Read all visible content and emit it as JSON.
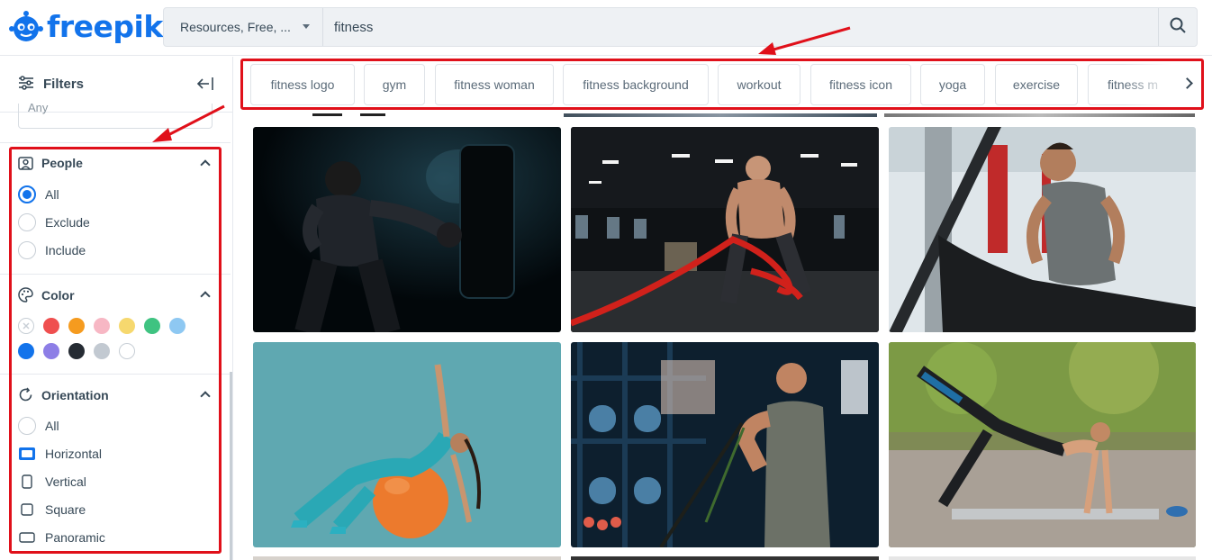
{
  "header": {
    "logo_text": "freepik",
    "search_type": "Resources, Free, ...",
    "search_value": "fitness",
    "brand_color": "#1273eb"
  },
  "sidebar": {
    "filters_label": "Filters",
    "any_select": "Any",
    "people": {
      "title": "People",
      "options": [
        {
          "label": "All",
          "selected": true
        },
        {
          "label": "Exclude",
          "selected": false
        },
        {
          "label": "Include",
          "selected": false
        }
      ]
    },
    "color": {
      "title": "Color",
      "swatches": [
        "none",
        "#ef4f4f",
        "#f59b1f",
        "#f7b7c4",
        "#f6d86e",
        "#3fc381",
        "#8ec8f2",
        "#1273eb",
        "#8d7ee6",
        "#252b33",
        "#c2c9d1",
        "#ffffff"
      ]
    },
    "orientation": {
      "title": "Orientation",
      "options": [
        {
          "label": "All",
          "icon": "radio-icon"
        },
        {
          "label": "Horizontal",
          "icon": "horizontal-icon",
          "selected": true
        },
        {
          "label": "Vertical",
          "icon": "vertical-icon"
        },
        {
          "label": "Square",
          "icon": "square-icon"
        },
        {
          "label": "Panoramic",
          "icon": "panoramic-icon"
        }
      ]
    }
  },
  "tags": [
    "fitness logo",
    "gym",
    "fitness woman",
    "fitness background",
    "workout",
    "fitness icon",
    "yoga",
    "exercise",
    "fitness m"
  ],
  "images": [
    {
      "subject": "boxer punching bag in dark"
    },
    {
      "subject": "man with battle ropes in gym"
    },
    {
      "subject": "man on treadmill"
    },
    {
      "subject": "woman on orange fitball"
    },
    {
      "subject": "man with resistance band in gym"
    },
    {
      "subject": "woman doing plank outdoors"
    }
  ],
  "annotation_color": "#e0101a"
}
